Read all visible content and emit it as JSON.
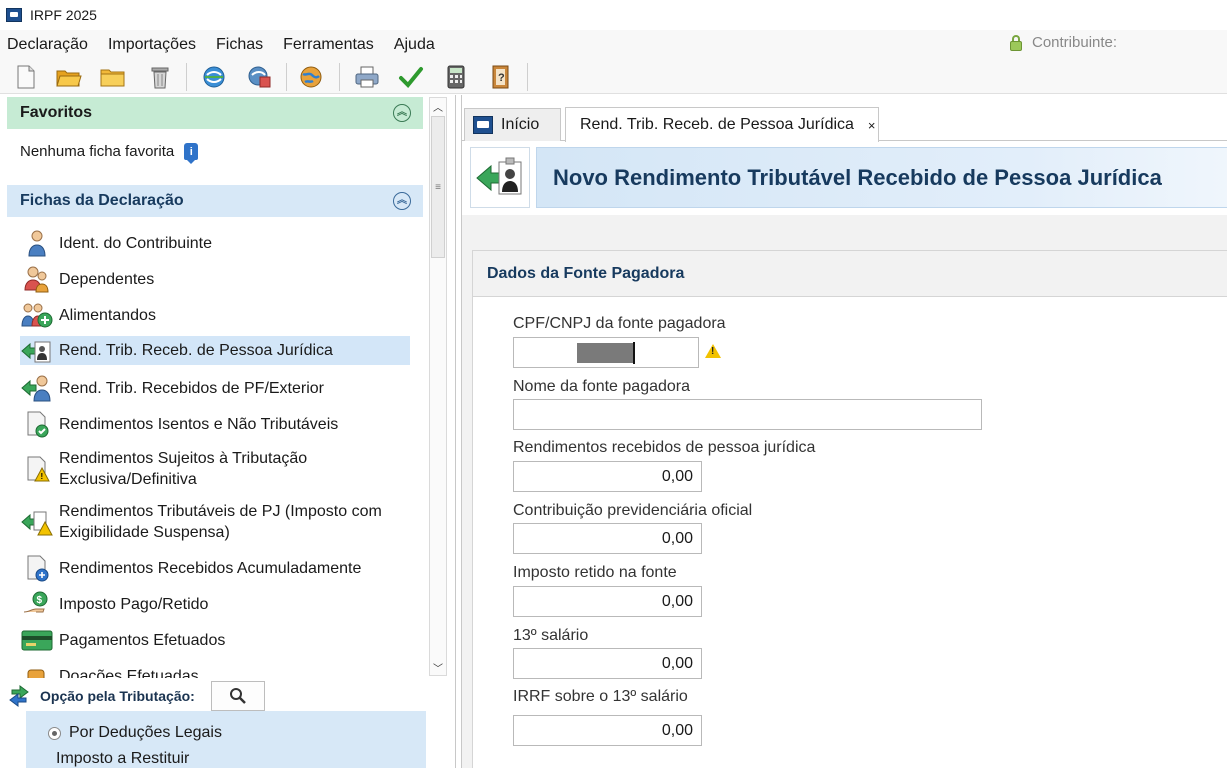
{
  "window": {
    "title": "IRPF 2025"
  },
  "menu": {
    "items": [
      "Declaração",
      "Importações",
      "Fichas",
      "Ferramentas",
      "Ajuda"
    ],
    "contribuinte_label": "Contribuinte:"
  },
  "toolbar": {
    "buttons": [
      "new-file-icon",
      "open-file-icon",
      "folder-icon",
      "trash-icon",
      "transmit-icon",
      "receipt-icon",
      "globe-icon",
      "print-icon",
      "check-icon",
      "calculator-icon",
      "help-book-icon"
    ]
  },
  "sidebar": {
    "favoritos": {
      "title": "Favoritos",
      "empty_text": "Nenhuma ficha favorita"
    },
    "fichas": {
      "title": "Fichas da Declaração",
      "items": [
        {
          "label": "Ident. do Contribuinte",
          "icon": "person-icon"
        },
        {
          "label": "Dependentes",
          "icon": "dependents-icon"
        },
        {
          "label": "Alimentandos",
          "icon": "alimentandos-icon"
        },
        {
          "label": "Rend. Trib. Receb. de Pessoa Jurídica",
          "icon": "income-pj-icon",
          "selected": true
        },
        {
          "label": "Rend. Trib. Recebidos de PF/Exterior",
          "icon": "income-pf-icon"
        },
        {
          "label": "Rendimentos Isentos e Não Tributáveis",
          "icon": "exempt-income-icon"
        },
        {
          "label": "Rendimentos Sujeitos à Tributação Exclusiva/Definitiva",
          "icon": "exclusive-tax-icon"
        },
        {
          "label": "Rendimentos Tributáveis de PJ (Imposto com Exigibilidade Suspensa)",
          "icon": "suspended-tax-icon"
        },
        {
          "label": "Rendimentos Recebidos Acumuladamente",
          "icon": "accumulated-income-icon"
        },
        {
          "label": "Imposto Pago/Retido",
          "icon": "tax-paid-icon"
        },
        {
          "label": "Pagamentos Efetuados",
          "icon": "payment-card-icon"
        },
        {
          "label": "Doações Efetuadas",
          "icon": "donation-icon"
        }
      ]
    },
    "opcao": {
      "title": "Opção pela Tributação:",
      "option": "Por Deduções Legais",
      "result_label": "Imposto a Restituir"
    }
  },
  "tabs": [
    {
      "label": "Início"
    },
    {
      "label": "Rend. Trib. Receb. de Pessoa Jurídica",
      "close": "×"
    }
  ],
  "page": {
    "title": "Novo Rendimento Tributável Recebido de Pessoa Jurídica",
    "section_title": "Dados da Fonte Pagadora",
    "fields": {
      "cpf_label": "CPF/CNPJ da fonte pagadora",
      "nome_label": "Nome da fonte pagadora",
      "nome_value": "",
      "rend_label": "Rendimentos recebidos de pessoa jurídica",
      "rend_value": "0,00",
      "contrib_label": "Contribuição previdenciária oficial",
      "contrib_value": "0,00",
      "imposto_label": "Imposto retido na fonte",
      "imposto_value": "0,00",
      "decimo_label": "13º salário",
      "decimo_value": "0,00",
      "irrf_label": "IRRF sobre o 13º salário",
      "irrf_value": "0,00"
    }
  },
  "colors": {
    "favoritos_header": "#c6ebd4",
    "fichas_header": "#d7e8f7",
    "selected_item": "#d3e6f8",
    "title_text": "#173a5e",
    "warning": "#f2c200"
  }
}
